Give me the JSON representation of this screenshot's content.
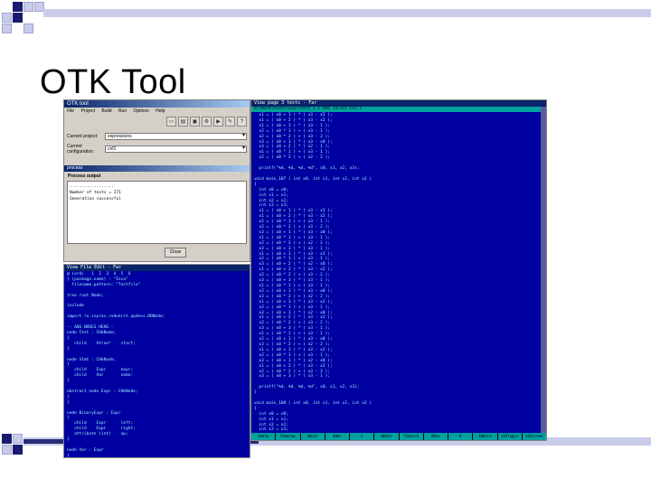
{
  "slide": {
    "title": "OTK Tool"
  },
  "otk_window": {
    "title": "OTK tool",
    "menu": [
      "File",
      "Project",
      "Build",
      "Run",
      "Options",
      "Help"
    ],
    "toolbar_icons": [
      "new-icon",
      "open-icon",
      "save-icon",
      "build-icon",
      "run-icon",
      "settings-icon",
      "help-icon"
    ],
    "current_project_label": "Current project:",
    "current_project_value": "expressions",
    "current_config_label": "Current configuration:",
    "current_config_value": "cnf1",
    "process_window": {
      "title": "process",
      "label": "Process output",
      "output_lines": [
        "..................",
        "Number of tests = 271",
        "Generation successful"
      ],
      "close_label": "Close"
    }
  },
  "left_editor": {
    "title": "View File Edit - Far",
    "lines": [
      "@ (ord)   1  2  3  4  5  6",
      "} (package.name) : \"Inca\"",
      "  filename.pattern: \"Testfile\"",
      "",
      "tree root Node;",
      "",
      "include",
      "",
      "import ru.ispras.redverst.apdexs.RBNode;",
      "",
      "-- ABS NODES HERE--",
      "node Test : CHkNode;",
      "{",
      "   child    Vtree*    start;",
      "}",
      "",
      "node Stmt : CHkNode;",
      "{",
      "   child    Expr      expr;",
      "   child    Var       name;",
      "}",
      "",
      "abstract node Expr : CHkNode;",
      "{",
      "}",
      "",
      "node BinaryExpr : Expr",
      "{",
      "   child    Expr      left;",
      "   child    Expr      right;",
      "   attribute (int)    op;",
      "}",
      "",
      "node Var : Expr",
      "{",
      "   attribute (int)    id;",
      "}",
      "",
      "node Constant : Expr",
      "{",
      "   attribute (int)    value;",
      "}"
    ]
  },
  "right_editor": {
    "title": "View page 3  tests - Far",
    "status": "D:\\Work\\tests\\expr\\test_1.c       866      13/321      Col 1",
    "lines": [
      "  x1 = ( x0 + 1 ) * ( x3 - x2 );",
      "  x1 = ( x0 + 2 ) * ( x3 - x2 );",
      "  x1 = ( x0 + 3 ) * ( x3 - 1 );",
      "  x2 = ( x0 * 1 ) + ( x3 - 1 );",
      "  x2 = ( x0 * 2 ) + ( x3 - 2 );",
      "  x3 = ( x0 + 1 ) * ( x3 - x0 );",
      "  x3 = ( x0 + 2 ) * ( x2 - 1 );",
      "  x1 = ( x0 * 1 ) + ( x3 - 1 );",
      "  x2 = ( x0 * 2 ) + ( x2 - 2 );",
      "",
      "  printf(\"%d, %d, %d, %d\", x0, x1, x2, x3);",
      "",
      "void main_107 ( int x0, int x1, int x2, int x3 )",
      "{",
      "  int x0 = x0;",
      "  int x1 = x1;",
      "  int x2 = x2;",
      "  int x3 = x3;",
      "  x1 = ( x0 + 1 ) * ( x3 - x2 );",
      "  x1 = ( x0 + 2 ) * ( x3 - x2 );",
      "  x2 = ( x0 * 1 ) + ( x3 - 1 );",
      "  x2 = ( x0 * 2 ) + ( x3 - 2 );",
      "  x3 = ( x0 + 1 ) * ( x3 - x0 );",
      "  x1 = ( x0 * 1 ) + ( x3 - 1 );",
      "  x2 = ( x0 * 2 ) + ( x2 - 2 );",
      "  x3 = ( x0 + 3 ) * ( x3 - 1 );",
      "  x1 = ( x0 + 1 ) * ( x3 - x2 );",
      "  x2 = ( x0 * 1 ) + ( x3 - 1 );",
      "  x3 = ( x0 + 2 ) * ( x2 - x0 );",
      "  x1 = ( x0 + 2 ) * ( x3 - x2 );",
      "  x2 = ( x0 * 2 ) + ( x3 - 2 );",
      "  x3 = ( x0 + 3 ) * ( x3 - 1 );",
      "  x1 = ( x0 * 1 ) + ( x3 - 1 );",
      "  x2 = ( x0 + 1 ) * ( x3 - x0 );",
      "  x3 = ( x0 * 2 ) + ( x2 - 2 );",
      "  x1 = ( x0 + 3 ) * ( x3 - x2 );",
      "  x2 = ( x0 * 1 ) + ( x3 - 1 );",
      "  x3 = ( x0 + 1 ) * ( x2 - x0 );",
      "  x1 = ( x0 + 2 ) * ( x3 - x2 );",
      "  x2 = ( x0 * 2 ) + ( x3 - 2 );",
      "  x3 = ( x0 + 3 ) * ( x3 - 1 );",
      "  x1 = ( x0 * 1 ) + ( x3 - 1 );",
      "  x2 = ( x0 + 1 ) * ( x3 - x0 );",
      "  x3 = ( x0 * 2 ) + ( x2 - 2 );",
      "  x1 = ( x0 + 3 ) * ( x3 - x2 );",
      "  x2 = ( x0 * 1 ) + ( x3 - 1 );",
      "  x3 = ( x0 + 1 ) * ( x2 - x0 );",
      "  x1 = ( x0 + 2 ) * ( x3 - x2 );",
      "  x2 = ( x0 * 2 ) + ( x3 - 2 );",
      "  x3 = ( x0 + 3 ) * ( x3 - 1 );",
      "",
      "  printf(\"%d, %d, %d, %d\", x0, x1, x2, x3);",
      "}",
      "",
      "void main_108 ( int x0, int x1, int x2, int x3 )",
      "{",
      "  int x0 = x0;",
      "  int x1 = x1;",
      "  int x2 = x2;",
      "  int x3 = x3;"
    ],
    "fkeys": [
      "1Help",
      "2Unwrap",
      "3Quit",
      "4Hex",
      "5",
      "6Edit",
      "7Search",
      "8Dos",
      "9",
      "10Quit",
      "11Plugin",
      "12Screen"
    ]
  }
}
